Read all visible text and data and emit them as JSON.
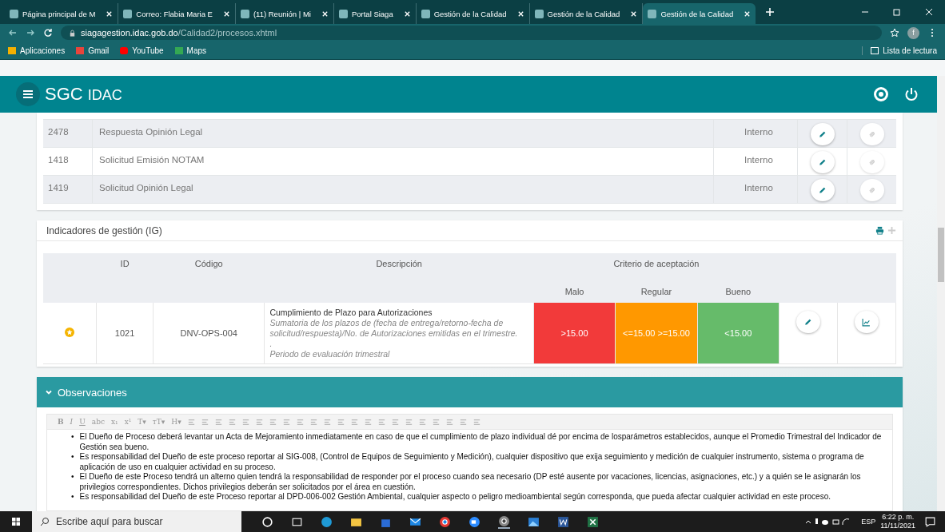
{
  "browser": {
    "tabs": [
      {
        "label": "Página principal de M",
        "selected": false
      },
      {
        "label": "Correo: Flabia Maria E",
        "selected": false
      },
      {
        "label": "(11) Reunión | Mi",
        "selected": false
      },
      {
        "label": "Portal Siaga",
        "selected": false
      },
      {
        "label": "Gestión de la Calidad",
        "selected": false
      },
      {
        "label": "Gestión de la Calidad",
        "selected": false
      },
      {
        "label": "Gestión de la Calidad",
        "selected": true
      }
    ],
    "url_host": "siagagestion.idac.gob.do",
    "url_path": "/Calidad2/procesos.xhtml",
    "bookmarks": [
      "Aplicaciones",
      "Gmail",
      "YouTube",
      "Maps"
    ],
    "reading_list": "Lista de lectura",
    "profile": "f"
  },
  "app": {
    "title": "SGC",
    "title_suffix": "IDAC"
  },
  "documents": {
    "rows": [
      {
        "id": "2478",
        "name": "Respuesta Opinión Legal",
        "scope": "Interno"
      },
      {
        "id": "1418",
        "name": "Solicitud Emisión NOTAM",
        "scope": "Interno"
      },
      {
        "id": "1419",
        "name": "Solicitud Opinión Legal",
        "scope": "Interno"
      }
    ]
  },
  "indicators": {
    "title": "Indicadores de gestión (IG)",
    "columns": {
      "id": "ID",
      "code": "Código",
      "description": "Descripción",
      "criteria": "Criterio de aceptación"
    },
    "levels": [
      {
        "label": "Malo"
      },
      {
        "label": "Regular"
      },
      {
        "label": "Bueno"
      }
    ],
    "rows": [
      {
        "id": "1021",
        "code": "DNV-OPS-004",
        "description": [
          {
            "kind": "title",
            "text": "Cumplimiento de Plazo para Autorizaciones"
          },
          {
            "kind": "italic",
            "text": "Sumatoria de los plazos de (fecha de entrega/retorno-fecha de solicitud/respuesta)/No. de Autorizaciones emitidas en el trimestre."
          },
          {
            "kind": "italic",
            "text": "."
          },
          {
            "kind": "italic",
            "text": "Periodo de evaluación trimestral"
          }
        ],
        "criteria": [
          {
            "text": ">15.00",
            "color": "#f23a3a"
          },
          {
            "text": "<=15.00 >=15.00",
            "color": "#ff9800"
          },
          {
            "text": "<15.00",
            "color": "#66bb6a"
          }
        ]
      }
    ]
  },
  "observations": {
    "title": "Observaciones",
    "toolbar": [
      {
        "kind": "text",
        "label": "B"
      },
      {
        "kind": "text",
        "label": "I"
      },
      {
        "kind": "text",
        "label": "U"
      },
      {
        "kind": "text",
        "label": "abc"
      },
      {
        "kind": "text",
        "label": "x₁"
      },
      {
        "kind": "text",
        "label": "x¹"
      },
      {
        "kind": "text",
        "label": "T▾"
      },
      {
        "kind": "text",
        "label": "тT▾"
      },
      {
        "kind": "text",
        "label": "H▾"
      },
      {
        "kind": "icon"
      },
      {
        "kind": "icon"
      },
      {
        "kind": "icon"
      },
      {
        "kind": "icon"
      },
      {
        "kind": "icon"
      },
      {
        "kind": "icon"
      },
      {
        "kind": "icon"
      },
      {
        "kind": "icon"
      },
      {
        "kind": "icon"
      },
      {
        "kind": "icon"
      },
      {
        "kind": "icon"
      },
      {
        "kind": "icon"
      },
      {
        "kind": "icon"
      },
      {
        "kind": "icon"
      },
      {
        "kind": "icon"
      },
      {
        "kind": "icon"
      },
      {
        "kind": "icon"
      },
      {
        "kind": "icon"
      },
      {
        "kind": "icon"
      },
      {
        "kind": "icon"
      },
      {
        "kind": "icon"
      },
      {
        "kind": "icon"
      }
    ],
    "bullets": [
      {
        "marker": "•",
        "text": "El Dueño de Proceso deberá levantar un Acta de Mejoramiento inmediatamente en caso de que el cumplimiento de plazo individual dé por encima de losparámetros establecidos, aunque el Promedio Trimestral del Indicador de Gestión sea bueno."
      },
      {
        "marker": "•",
        "text": "Es responsabilidad del Dueño de este proceso reportar al SIG-008, (Control de Equipos de Seguimiento y Medición), cualquier dispositivo que exija seguimiento y medición de cualquier instrumento, sistema o programa de aplicación de uso en cualquier actividad en su proceso."
      },
      {
        "marker": "•",
        "text": "El Dueño de este Proceso tendrá un alterno quien tendrá la responsabilidad de responder por el proceso cuando sea necesario (DP esté ausente por vacaciones, licencias, asignaciones, etc.) y a quién se le asignarán los privilegios correspondientes. Dichos privilegios deberán ser solicitados por el área en cuestión."
      },
      {
        "marker": "•",
        "text": "Es responsabilidad del Dueño de este Proceso reportar al DPD-006-002 Gestión Ambiental, cualquier aspecto o peligro medioambiental según corresponda, que pueda afectar cualquier actividad en este proceso."
      }
    ]
  },
  "taskbar": {
    "search_placeholder": "Escribe aquí para buscar",
    "language": "ESP",
    "time": "6:22 p. m.",
    "date": "11/11/2021"
  }
}
